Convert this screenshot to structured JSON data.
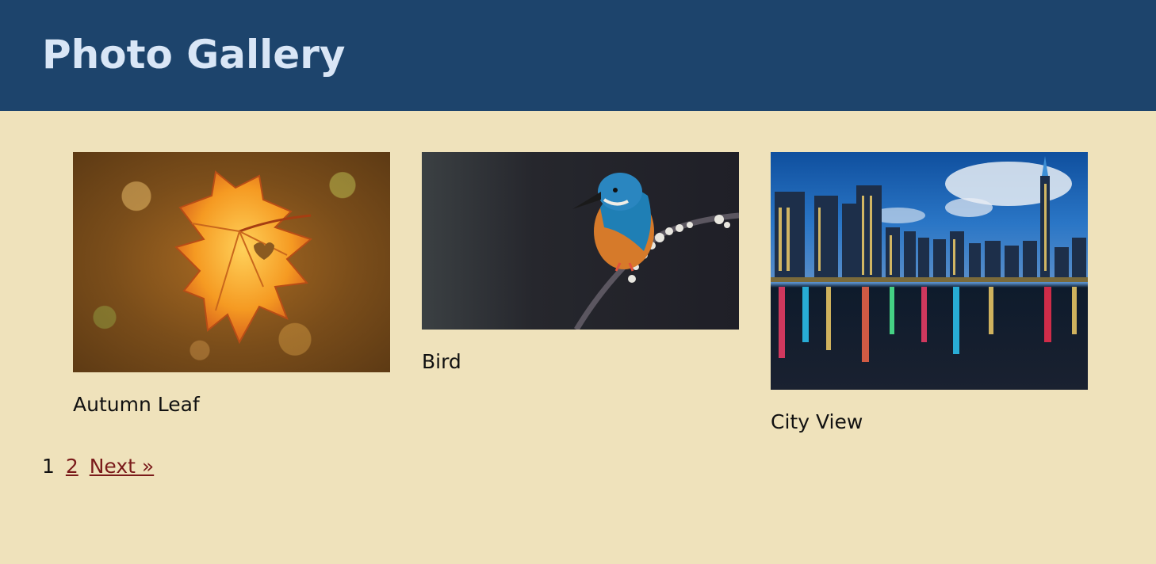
{
  "header": {
    "title": "Photo Gallery"
  },
  "gallery": {
    "items": [
      {
        "caption": "Autumn Leaf",
        "image": "autumn-leaf-photo"
      },
      {
        "caption": "Bird",
        "image": "kingfisher-bird-photo"
      },
      {
        "caption": "City View",
        "image": "city-skyline-photo"
      }
    ]
  },
  "pagination": {
    "current": "1",
    "page2": "2",
    "next": "Next »"
  },
  "colors": {
    "header_bg": "#1d446c",
    "header_text": "#d9e6f6",
    "page_bg": "#efe2bb",
    "link": "#7a1a1a"
  }
}
